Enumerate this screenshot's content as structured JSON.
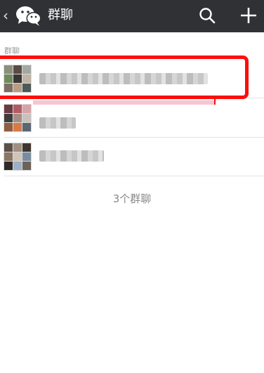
{
  "header": {
    "back_glyph": "‹",
    "title": "群聊",
    "icons": [
      "back-icon",
      "wechat-logo-icon",
      "search-icon",
      "plus-icon"
    ],
    "background": "#2f3135"
  },
  "section": {
    "label": "群聊"
  },
  "groups": [
    {
      "name_blurred": true,
      "selected": true
    },
    {
      "name_blurred": true,
      "selected": false
    },
    {
      "name_blurred": true,
      "selected": false
    }
  ],
  "footer": {
    "count_text": "3个群聊"
  },
  "colors": {
    "highlight": "#ff0d0d",
    "divider": "#e3e3e3",
    "muted_text": "#8a8a8a"
  }
}
